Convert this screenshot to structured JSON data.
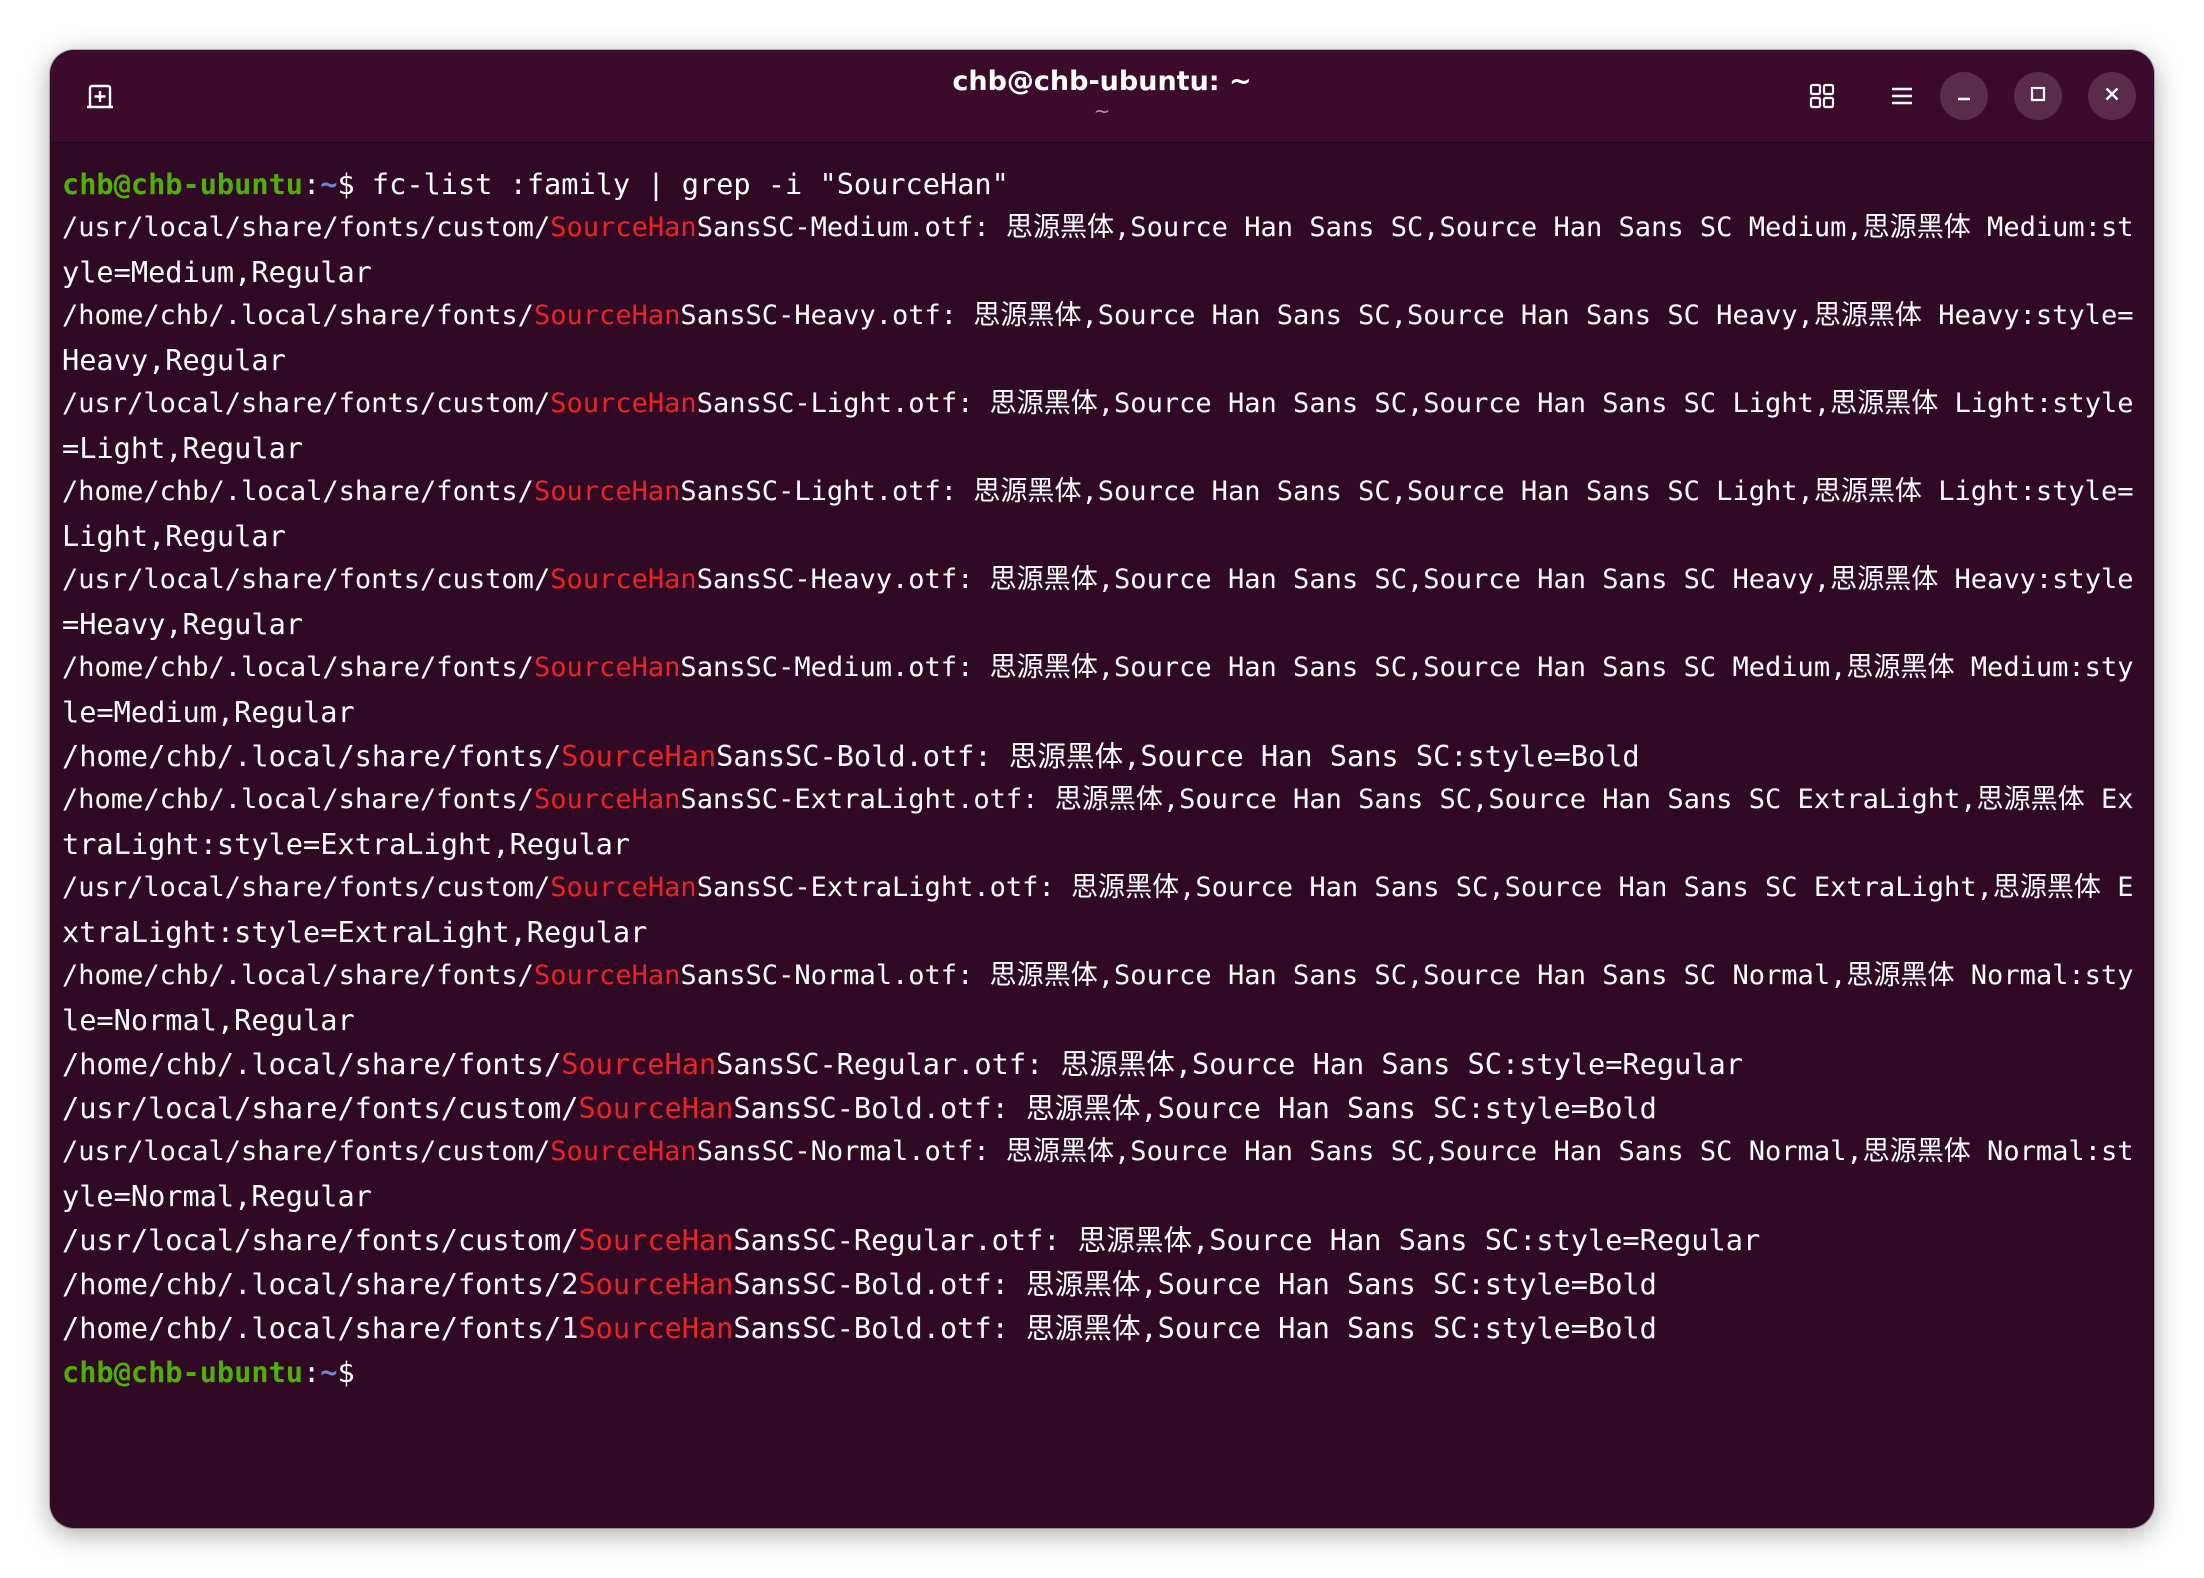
{
  "window": {
    "title": "chb@chb-ubuntu: ~",
    "subtitle": "~"
  },
  "icons": {
    "new_tab": "new-tab-icon",
    "grid": "grid-view-icon",
    "menu": "hamburger-menu-icon",
    "minimize": "minimize-icon",
    "maximize": "maximize-icon",
    "close": "close-icon"
  },
  "colors": {
    "terminal_bg": "#300a24",
    "headerbar_bg": "#3c0b2c",
    "prompt_user": "#4eb000",
    "prompt_path": "#6b87d6",
    "grep_match": "#e82424",
    "text": "#ffffff"
  },
  "prompt": {
    "user_host": "chb@chb-ubuntu",
    "colon": ":",
    "path": "~",
    "dollar": "$"
  },
  "command": " fc-list :family | grep -i \"SourceHan\"",
  "match_text": "SourceHan",
  "lines": [
    {
      "pre": "/usr/local/share/fonts/custom/",
      "match": "SourceHan",
      "post": "SansSC-Medium.otf: 思源黑体,Source Han Sans SC,Source Han Sans SC Medium,思源黑体 Medium:st"
    },
    {
      "pre": "yle=Medium,Regular",
      "match": "",
      "post": ""
    },
    {
      "pre": "/home/chb/.local/share/fonts/",
      "match": "SourceHan",
      "post": "SansSC-Heavy.otf: 思源黑体,Source Han Sans SC,Source Han Sans SC Heavy,思源黑体 Heavy:style="
    },
    {
      "pre": "Heavy,Regular",
      "match": "",
      "post": ""
    },
    {
      "pre": "/usr/local/share/fonts/custom/",
      "match": "SourceHan",
      "post": "SansSC-Light.otf: 思源黑体,Source Han Sans SC,Source Han Sans SC Light,思源黑体 Light:style"
    },
    {
      "pre": "=Light,Regular",
      "match": "",
      "post": ""
    },
    {
      "pre": "/home/chb/.local/share/fonts/",
      "match": "SourceHan",
      "post": "SansSC-Light.otf: 思源黑体,Source Han Sans SC,Source Han Sans SC Light,思源黑体 Light:style="
    },
    {
      "pre": "Light,Regular",
      "match": "",
      "post": ""
    },
    {
      "pre": "/usr/local/share/fonts/custom/",
      "match": "SourceHan",
      "post": "SansSC-Heavy.otf: 思源黑体,Source Han Sans SC,Source Han Sans SC Heavy,思源黑体 Heavy:style"
    },
    {
      "pre": "=Heavy,Regular",
      "match": "",
      "post": ""
    },
    {
      "pre": "/home/chb/.local/share/fonts/",
      "match": "SourceHan",
      "post": "SansSC-Medium.otf: 思源黑体,Source Han Sans SC,Source Han Sans SC Medium,思源黑体 Medium:sty"
    },
    {
      "pre": "le=Medium,Regular",
      "match": "",
      "post": ""
    },
    {
      "pre": "/home/chb/.local/share/fonts/",
      "match": "SourceHan",
      "post": "SansSC-Bold.otf: 思源黑体,Source Han Sans SC:style=Bold"
    },
    {
      "pre": "/home/chb/.local/share/fonts/",
      "match": "SourceHan",
      "post": "SansSC-ExtraLight.otf: 思源黑体,Source Han Sans SC,Source Han Sans SC ExtraLight,思源黑体 Ex"
    },
    {
      "pre": "traLight:style=ExtraLight,Regular",
      "match": "",
      "post": ""
    },
    {
      "pre": "/usr/local/share/fonts/custom/",
      "match": "SourceHan",
      "post": "SansSC-ExtraLight.otf: 思源黑体,Source Han Sans SC,Source Han Sans SC ExtraLight,思源黑体 E"
    },
    {
      "pre": "xtraLight:style=ExtraLight,Regular",
      "match": "",
      "post": ""
    },
    {
      "pre": "/home/chb/.local/share/fonts/",
      "match": "SourceHan",
      "post": "SansSC-Normal.otf: 思源黑体,Source Han Sans SC,Source Han Sans SC Normal,思源黑体 Normal:sty"
    },
    {
      "pre": "le=Normal,Regular",
      "match": "",
      "post": ""
    },
    {
      "pre": "/home/chb/.local/share/fonts/",
      "match": "SourceHan",
      "post": "SansSC-Regular.otf: 思源黑体,Source Han Sans SC:style=Regular"
    },
    {
      "pre": "/usr/local/share/fonts/custom/",
      "match": "SourceHan",
      "post": "SansSC-Bold.otf: 思源黑体,Source Han Sans SC:style=Bold"
    },
    {
      "pre": "/usr/local/share/fonts/custom/",
      "match": "SourceHan",
      "post": "SansSC-Normal.otf: 思源黑体,Source Han Sans SC,Source Han Sans SC Normal,思源黑体 Normal:st"
    },
    {
      "pre": "yle=Normal,Regular",
      "match": "",
      "post": ""
    },
    {
      "pre": "/usr/local/share/fonts/custom/",
      "match": "SourceHan",
      "post": "SansSC-Regular.otf: 思源黑体,Source Han Sans SC:style=Regular"
    },
    {
      "pre": "/home/chb/.local/share/fonts/2",
      "match": "SourceHan",
      "post": "SansSC-Bold.otf: 思源黑体,Source Han Sans SC:style=Bold"
    },
    {
      "pre": "/home/chb/.local/share/fonts/1",
      "match": "SourceHan",
      "post": "SansSC-Bold.otf: 思源黑体,Source Han Sans SC:style=Bold"
    }
  ]
}
